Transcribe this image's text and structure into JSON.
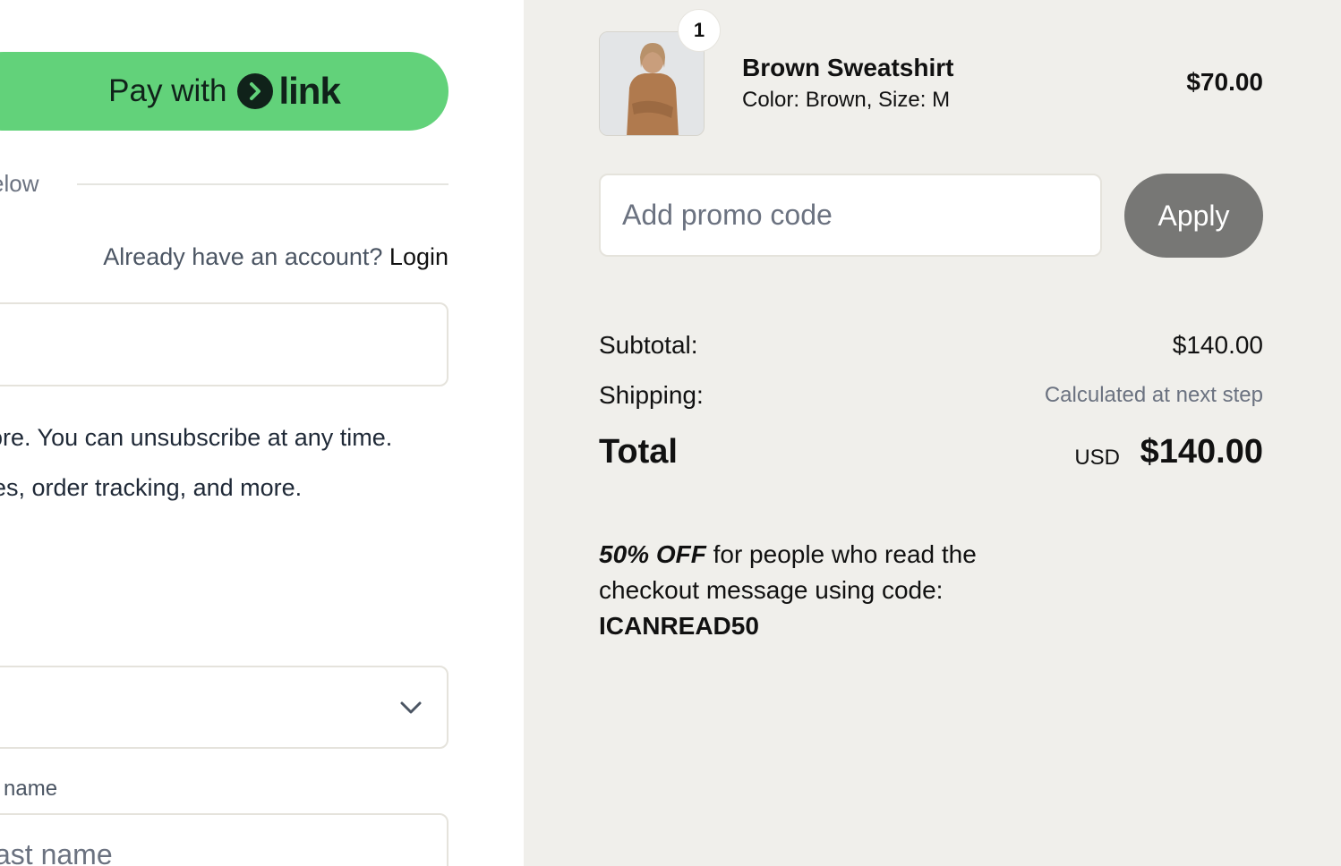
{
  "checkout": {
    "pay_with_label": "Pay with",
    "link_word": "link",
    "divider_text": "elow",
    "account_prompt": "Already have an account?",
    "login_label": "Login",
    "notice_line1": "ore. You can unsubscribe at any time.",
    "notice_line2": "es, order tracking, and more.",
    "last_name_label": "name",
    "last_name_placeholder": "ast name"
  },
  "cart": {
    "item": {
      "quantity": "1",
      "name": "Brown Sweatshirt",
      "variant": "Color: Brown, Size: M",
      "price": "$70.00"
    },
    "promo": {
      "placeholder": "Add promo code",
      "apply_label": "Apply"
    },
    "summary": {
      "subtotal_label": "Subtotal:",
      "subtotal_value": "$140.00",
      "shipping_label": "Shipping:",
      "shipping_value": "Calculated at next step",
      "total_label": "Total",
      "currency": "USD",
      "total_value": "$140.00"
    },
    "message": {
      "discount": "50% OFF",
      "text": "for people who read the checkout message using code:",
      "code": "ICANREAD50"
    }
  },
  "colors": {
    "link_green": "#62d27a",
    "summary_bg": "#f0efeb",
    "apply_gray": "#777775"
  },
  "icons": [
    "link-arrow-icon",
    "chevron-down-icon"
  ]
}
